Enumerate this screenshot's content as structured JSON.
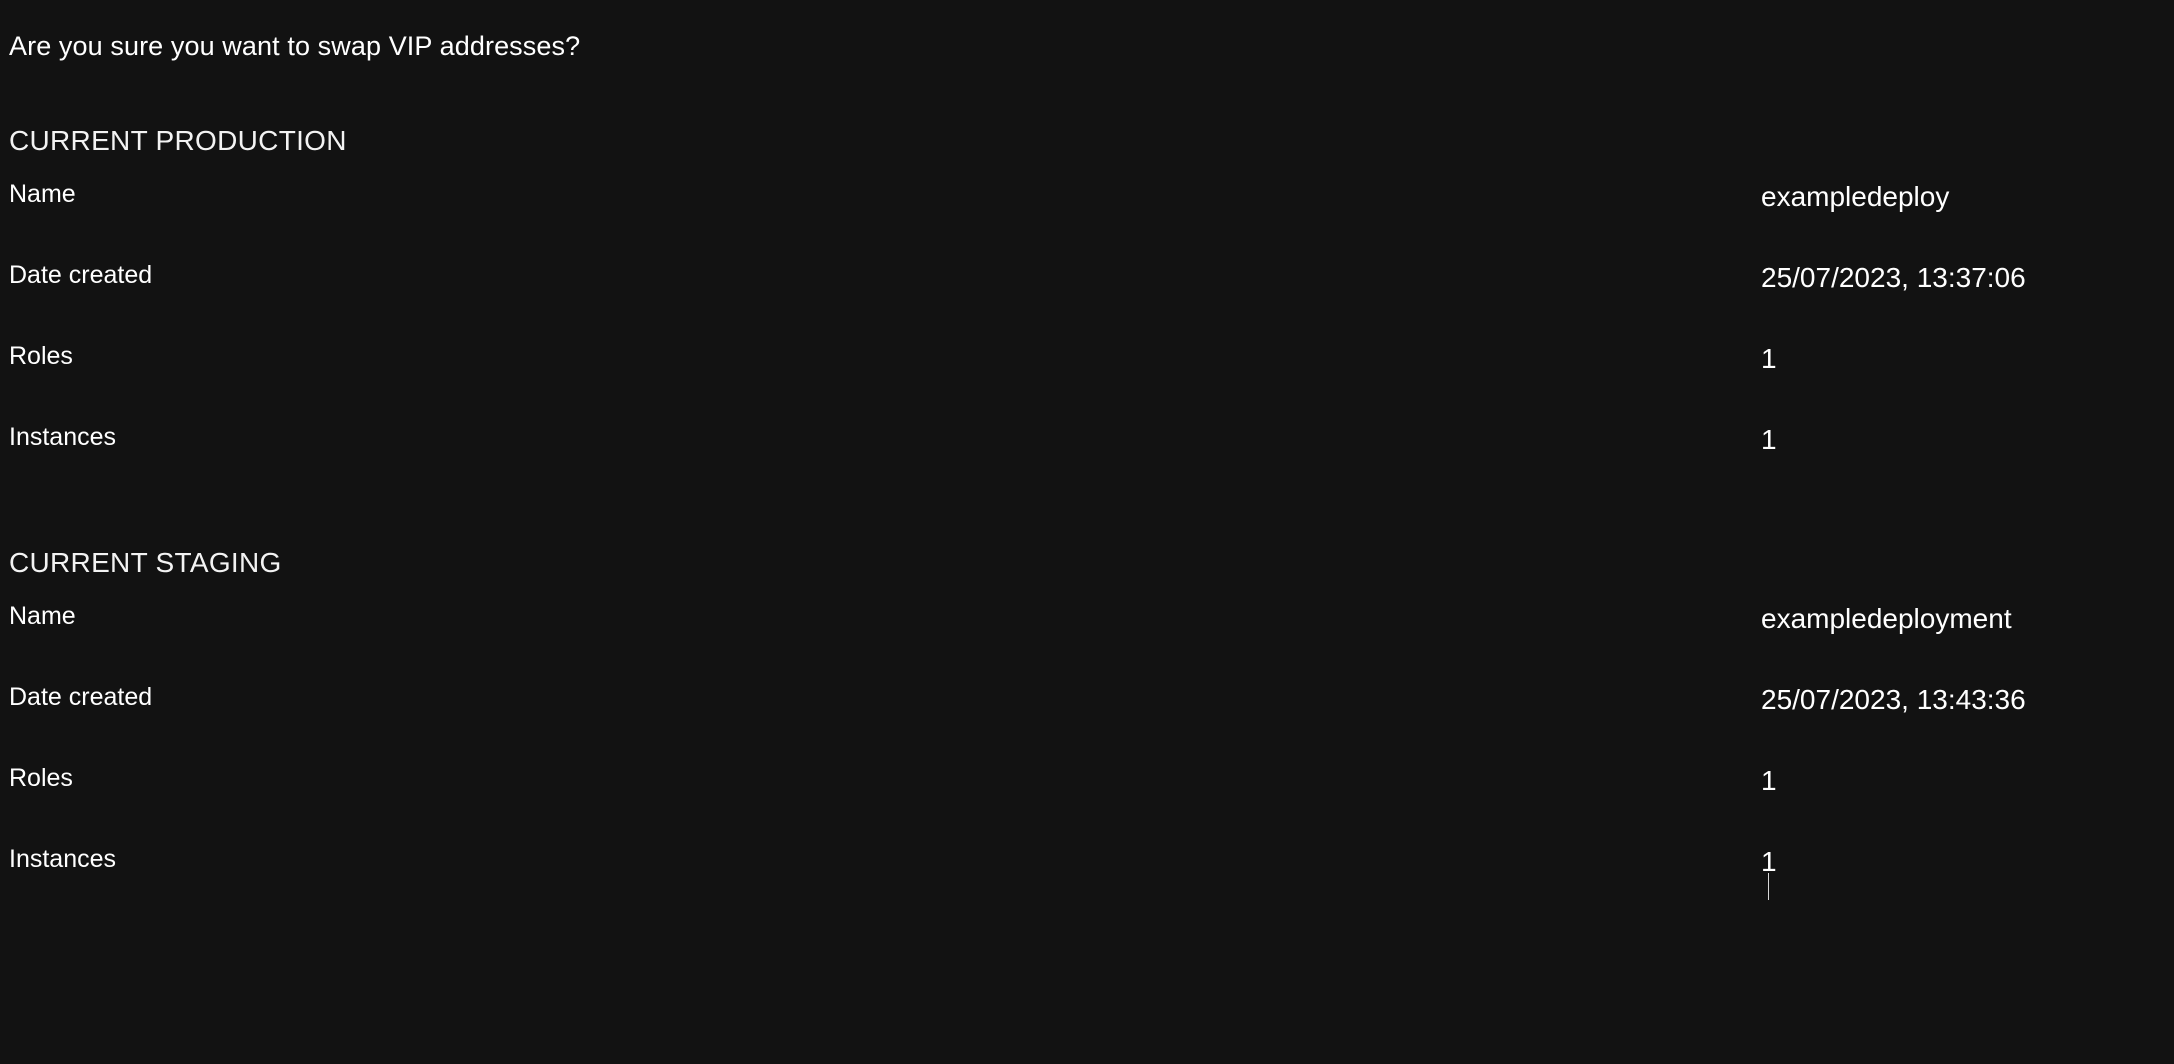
{
  "dialog": {
    "question": "Are you sure you want to swap VIP addresses?",
    "sections": [
      {
        "title": "CURRENT PRODUCTION",
        "rows": [
          {
            "label": "Name",
            "value": "exampledeploy"
          },
          {
            "label": "Date created",
            "value": "25/07/2023, 13:37:06"
          },
          {
            "label": "Roles",
            "value": "1"
          },
          {
            "label": "Instances",
            "value": "1"
          }
        ]
      },
      {
        "title": "CURRENT STAGING",
        "rows": [
          {
            "label": "Name",
            "value": "exampledeployment"
          },
          {
            "label": "Date created",
            "value": "25/07/2023, 13:43:36"
          },
          {
            "label": "Roles",
            "value": "1"
          },
          {
            "label": "Instances",
            "value": "1"
          }
        ]
      }
    ]
  },
  "theme": {
    "background": "#121212",
    "text": "#ffffff",
    "section_title": "#f3f3f3"
  }
}
